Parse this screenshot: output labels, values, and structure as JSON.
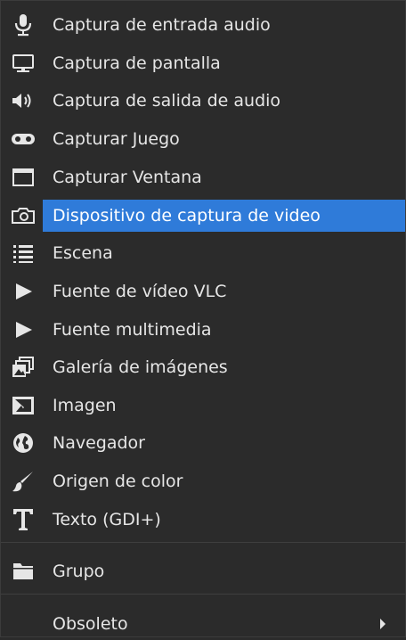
{
  "menu": {
    "items": [
      {
        "label": "Captura de entrada audio",
        "icon": "microphone-icon"
      },
      {
        "label": "Captura de pantalla",
        "icon": "monitor-icon"
      },
      {
        "label": "Captura de salida de audio",
        "icon": "speaker-icon"
      },
      {
        "label": "Capturar Juego",
        "icon": "gamepad-icon"
      },
      {
        "label": "Capturar Ventana",
        "icon": "window-icon"
      },
      {
        "label": "Dispositivo de captura de video",
        "icon": "camera-icon"
      },
      {
        "label": "Escena",
        "icon": "list-icon"
      },
      {
        "label": "Fuente de vídeo VLC",
        "icon": "play-icon"
      },
      {
        "label": "Fuente multimedia",
        "icon": "play-icon"
      },
      {
        "label": "Galería de imágenes",
        "icon": "gallery-icon"
      },
      {
        "label": "Imagen",
        "icon": "image-icon"
      },
      {
        "label": "Navegador",
        "icon": "globe-icon"
      },
      {
        "label": "Origen de color",
        "icon": "brush-icon"
      },
      {
        "label": "Texto (GDI+)",
        "icon": "text-icon"
      }
    ],
    "group": {
      "label": "Grupo",
      "icon": "folder-icon"
    },
    "deprecated": {
      "label": "Obsoleto",
      "icon": "submenu-arrow-icon"
    }
  },
  "colors": {
    "background": "#2b2b2b",
    "highlight": "#2f7bd9",
    "text": "#e6e6e6"
  }
}
